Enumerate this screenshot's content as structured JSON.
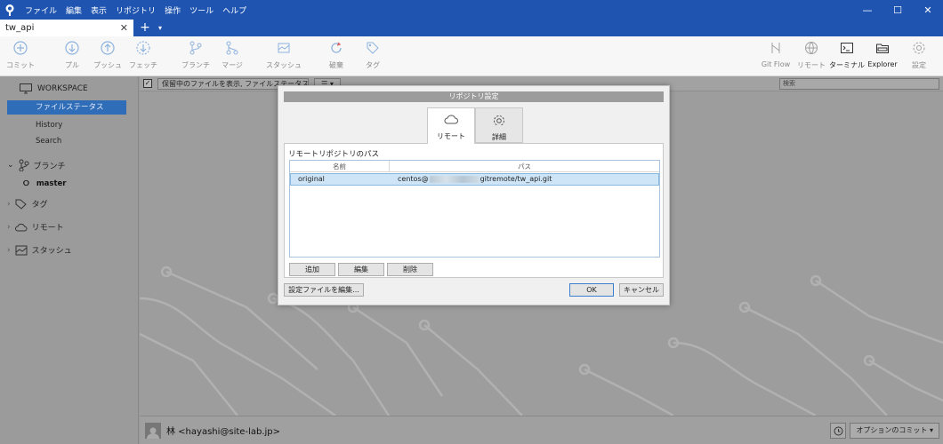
{
  "titlebar": {
    "menu": [
      "ファイル",
      "編集",
      "表示",
      "リポジトリ",
      "操作",
      "ツール",
      "ヘルプ"
    ],
    "minimize": "—",
    "maximize": "☐",
    "close": "✕"
  },
  "tabs": [
    {
      "label": "tw_api",
      "close": "✕"
    }
  ],
  "tab_add": "+",
  "tab_dropdown": "▾",
  "toolbar": {
    "commit": "コミット",
    "pull": "プル",
    "push": "プッシュ",
    "fetch": "フェッチ",
    "branch": "ブランチ",
    "merge": "マージ",
    "stash": "スタッシュ",
    "discard": "破棄",
    "tag": "タグ",
    "gitflow": "Git Flow",
    "remote": "リモート",
    "terminal": "ターミナル",
    "explorer": "Explorer",
    "settings": "設定"
  },
  "sidebar": {
    "workspace": "WORKSPACE",
    "file_status": "ファイルステータス",
    "history": "History",
    "search": "Search",
    "branches": "ブランチ",
    "master": "master",
    "tags": "タグ",
    "remotes": "リモート",
    "stashes": "スタッシュ"
  },
  "filterbar": {
    "checked": "✓",
    "filter_value": "保留中のファイルを表示, ファイルステータス順",
    "filter_arrow": "▾",
    "view_value": "☰ ▾",
    "search_placeholder": "検索"
  },
  "dialog": {
    "title": "リポジトリ設定",
    "tab_remote": "リモート",
    "tab_advanced": "詳細",
    "section_label": "リモートリポジトリのパス",
    "col_name": "名前",
    "col_path": "パス",
    "remotes": [
      {
        "name": "original",
        "path_prefix": "centos@",
        "path_suffix": "gitremote/tw_api.git"
      }
    ],
    "add": "追加",
    "edit": "編集",
    "delete": "削除",
    "edit_config": "設定ファイルを編集...",
    "ok": "OK",
    "cancel": "キャンセル"
  },
  "bottombar": {
    "author": "林 <hayashi@site-lab.jp>",
    "commit_options": "オプションのコミット ▾"
  },
  "colors": {
    "titlebar": "#1f55b0",
    "selection": "#2f6db8",
    "row_highlight": "#cde5f7"
  }
}
